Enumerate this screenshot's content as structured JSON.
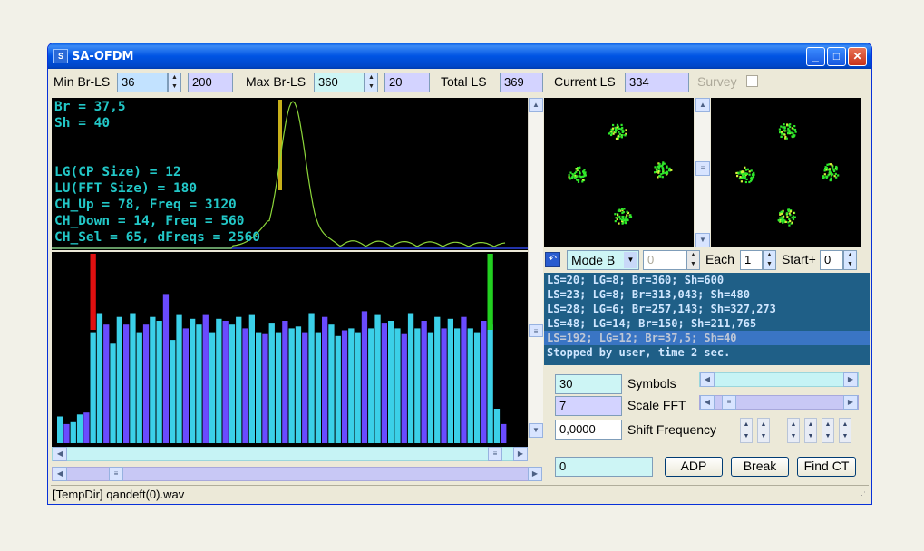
{
  "window": {
    "title": "SA-OFDM"
  },
  "toolbar": {
    "min_br_ls_label": "Min Br-LS",
    "min_br_ls_value": "36",
    "min_br_ls_extra": "200",
    "max_br_ls_label": "Max Br-LS",
    "max_br_ls_value": "360",
    "max_br_ls_extra": "20",
    "total_ls_label": "Total LS",
    "total_ls_value": "369",
    "current_ls_label": "Current LS",
    "current_ls_value": "334",
    "survey_label": "Survey"
  },
  "spectrum": {
    "lines": [
      "Br = 37,5",
      "Sh = 40",
      "",
      "",
      "LG(CP Size) = 12",
      "LU(FFT Size) = 180",
      "CH_Up = 78, Freq = 3120",
      "CH_Down = 14, Freq = 560",
      "CH_Sel = 65, dFreqs = 2560"
    ]
  },
  "bars": {
    "values": [
      0.14,
      0.1,
      0.11,
      0.15,
      0.16,
      0.58,
      0.68,
      0.62,
      0.52,
      0.66,
      0.62,
      0.68,
      0.58,
      0.62,
      0.66,
      0.64,
      0.78,
      0.54,
      0.67,
      0.6,
      0.65,
      0.62,
      0.67,
      0.58,
      0.65,
      0.64,
      0.62,
      0.66,
      0.6,
      0.67,
      0.58,
      0.57,
      0.63,
      0.58,
      0.64,
      0.6,
      0.61,
      0.58,
      0.68,
      0.58,
      0.66,
      0.62,
      0.56,
      0.59,
      0.6,
      0.58,
      0.69,
      0.6,
      0.67,
      0.63,
      0.64,
      0.6,
      0.57,
      0.68,
      0.6,
      0.64,
      0.58,
      0.66,
      0.6,
      0.65,
      0.6,
      0.66,
      0.6,
      0.58,
      0.64,
      0.62,
      0.18,
      0.1
    ],
    "marker_up": "red",
    "marker_down": "green"
  },
  "controls": {
    "mode_value": "Mode B",
    "mode_num": "0",
    "each_label": "Each",
    "each_value": "1",
    "start_label": "Start+",
    "start_value": "0",
    "symbols_value": "30",
    "symbols_label": "Symbols",
    "scale_fft_value": "7",
    "scale_fft_label": "Scale FFT",
    "shift_value": "0,0000",
    "shift_label": "Shift Frequency",
    "result_value": "0",
    "adp_label": "ADP",
    "break_label": "Break",
    "find_ct_label": "Find CT"
  },
  "log": {
    "lines": [
      "LS=20; LG=8; Br=360; Sh=600",
      "LS=23; LG=8; Br=313,043; Sh=480",
      "LS=28; LG=6; Br=257,143; Sh=327,273",
      "LS=48; LG=14; Br=150; Sh=211,765",
      "LS=192; LG=12; Br=37,5; Sh=40",
      "Stopped by user, time 2 sec."
    ]
  },
  "status": {
    "text": "[TempDir] qandeft(0).wav"
  },
  "colors": {
    "accent_bar": "#3bd0e8",
    "violet_bar": "#6a4bff",
    "spectrum_line": "#8cd63a",
    "marker_yellow": "#c8b01a"
  }
}
